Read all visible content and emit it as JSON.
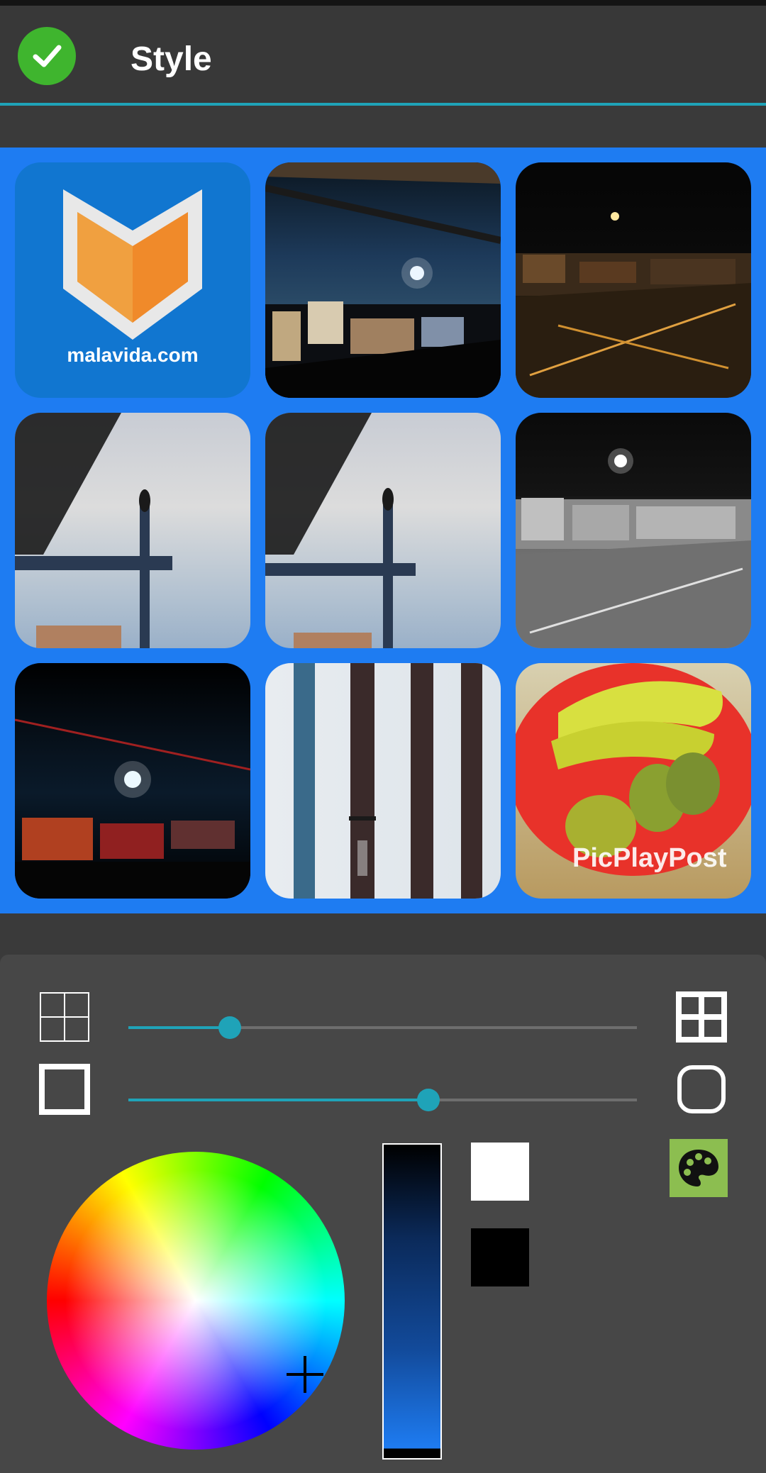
{
  "header": {
    "title": "Style"
  },
  "grid": {
    "tiles": [
      {
        "id": "malavida",
        "logo_text": "malavida.com"
      },
      {
        "id": "balcony-moon-night"
      },
      {
        "id": "city-night-moon"
      },
      {
        "id": "bird-on-pole-1"
      },
      {
        "id": "bird-on-pole-2"
      },
      {
        "id": "city-night-bw"
      },
      {
        "id": "moon-over-city-dark"
      },
      {
        "id": "wind-chimes"
      },
      {
        "id": "fruit-bowl",
        "watermark": "PicPlayPost"
      }
    ]
  },
  "controls": {
    "spacing_slider": {
      "value": 0.2
    },
    "corner_slider": {
      "value": 0.59
    },
    "icons": [
      "grid-thin-icon",
      "grid-thick-icon",
      "square-corner-icon",
      "rounded-corner-icon",
      "palette-icon",
      "check-icon"
    ]
  },
  "colors": {
    "accent": "#1fa3b8",
    "background_blue": "#1e7cf2",
    "check_green": "#3fb52e",
    "palette_green": "#8cbe50",
    "swatch_white": "#ffffff",
    "swatch_black": "#000000"
  }
}
